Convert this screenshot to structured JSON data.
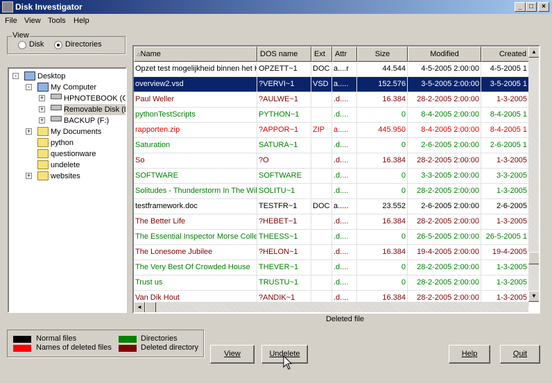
{
  "window": {
    "title": "Disk Investigator",
    "controls": [
      "_",
      "□",
      "×"
    ]
  },
  "menu": [
    "File",
    "View",
    "Tools",
    "Help"
  ],
  "view_group": {
    "label": "View",
    "options": [
      "Disk",
      "Directories"
    ],
    "selected": "Directories"
  },
  "tree": [
    {
      "label": "Desktop",
      "level": 0,
      "expander": "-",
      "icon": "desktop-icon"
    },
    {
      "label": "My Computer",
      "level": 1,
      "expander": "-",
      "icon": "computer-icon"
    },
    {
      "label": "HPNOTEBOOK (C:)",
      "level": 2,
      "expander": "+",
      "icon": "drive-icon"
    },
    {
      "label": "Removable Disk (D:)",
      "level": 2,
      "expander": "+",
      "icon": "drive-icon",
      "selected": true
    },
    {
      "label": "BACKUP (F:)",
      "level": 2,
      "expander": "+",
      "icon": "drive-icon"
    },
    {
      "label": "My Documents",
      "level": 1,
      "expander": "+",
      "icon": "documents-folder-icon"
    },
    {
      "label": "python",
      "level": 1,
      "expander": "",
      "icon": "folder-icon"
    },
    {
      "label": "questionware",
      "level": 1,
      "expander": "",
      "icon": "folder-icon"
    },
    {
      "label": "undelete",
      "level": 1,
      "expander": "",
      "icon": "folder-icon"
    },
    {
      "label": "websites",
      "level": 1,
      "expander": "+",
      "icon": "folder-icon"
    }
  ],
  "columns": [
    "Name",
    "DOS name",
    "Ext",
    "Attr",
    "Size",
    "Modified",
    "Created"
  ],
  "colors": {
    "normal": "#000000",
    "deleted_file": "#e00000",
    "directory": "#008000",
    "deleted_directory": "#800000",
    "selection": "#0a246a"
  },
  "rows": [
    {
      "type": "normal",
      "cells": [
        "Opzet test mogelijkheid binnen het Kc",
        "OPZETT~1",
        "DOC",
        "a....r",
        "44.544",
        "4-5-2005 2:00:00",
        "4-5-2005 1"
      ]
    },
    {
      "type": "deleted_file",
      "selected": true,
      "cells": [
        "overview2.vsd",
        "?VERVI~1",
        "VSD",
        "a.....",
        "152.576",
        "3-5-2005 2:00:00",
        "3-5-2005 1"
      ]
    },
    {
      "type": "deleted_directory",
      "cells": [
        "Paul Weller",
        "?AULWE~1",
        "",
        ".d....",
        "16.384",
        "28-2-2005 2:00:00",
        "1-3-2005"
      ]
    },
    {
      "type": "directory",
      "cells": [
        "pythonTestScripts",
        "PYTHON~1",
        "",
        ".d....",
        "0",
        "8-4-2005 2:00:00",
        "8-4-2005 1"
      ]
    },
    {
      "type": "deleted_file",
      "cells": [
        "rapporten.zip",
        "?APPOR~1",
        "ZIP",
        "a.....",
        "445.950",
        "8-4-2005 2:00:00",
        "8-4-2005 1"
      ]
    },
    {
      "type": "directory",
      "cells": [
        "Saturation",
        "SATURA~1",
        "",
        ".d....",
        "0",
        "2-6-2005 2:00:00",
        "2-6-2005 1"
      ]
    },
    {
      "type": "deleted_directory",
      "cells": [
        "So",
        "?O",
        "",
        ".d....",
        "16.384",
        "28-2-2005 2:00:00",
        "1-3-2005"
      ]
    },
    {
      "type": "directory",
      "cells": [
        "SOFTWARE",
        "SOFTWARE",
        "",
        ".d....",
        "0",
        "3-3-2005 2:00:00",
        "3-3-2005"
      ]
    },
    {
      "type": "directory",
      "cells": [
        "Solitudes - Thunderstorm In The Wild",
        "SOLITU~1",
        "",
        ".d....",
        "0",
        "28-2-2005 2:00:00",
        "1-3-2005"
      ]
    },
    {
      "type": "normal",
      "cells": [
        "testframework.doc",
        "TESTFR~1",
        "DOC",
        "a.....",
        "23.552",
        "2-6-2005 2:00:00",
        "2-6-2005"
      ]
    },
    {
      "type": "deleted_directory",
      "cells": [
        "The Better Life",
        "?HEBET~1",
        "",
        ".d....",
        "16.384",
        "28-2-2005 2:00:00",
        "1-3-2005"
      ]
    },
    {
      "type": "directory",
      "cells": [
        "The Essential Inspector Morse Collec",
        "THEESS~1",
        "",
        ".d....",
        "0",
        "26-5-2005 2:00:00",
        "26-5-2005 1"
      ]
    },
    {
      "type": "deleted_directory",
      "cells": [
        "The Lonesome Jubilee",
        "?HELON~1",
        "",
        ".d....",
        "16.384",
        "19-4-2005 2:00:00",
        "19-4-2005"
      ]
    },
    {
      "type": "directory",
      "cells": [
        "The Very Best Of Crowded House",
        "THEVER~1",
        "",
        ".d....",
        "0",
        "28-2-2005 2:00:00",
        "1-3-2005"
      ]
    },
    {
      "type": "directory",
      "cells": [
        "Trust us",
        "TRUSTU~1",
        "",
        ".d....",
        "0",
        "28-2-2005 2:00:00",
        "1-3-2005"
      ]
    },
    {
      "type": "deleted_directory",
      "cells": [
        "Van Dik Hout",
        "?ANDIK~1",
        "",
        ".d....",
        "16.384",
        "28-2-2005 2:00:00",
        "1-3-2005"
      ]
    }
  ],
  "status": "Deleted file",
  "legend": {
    "normal": "Normal files",
    "deleted_file": "Names of deleted files",
    "directory": "Directories",
    "deleted_directory": "Deleted directory"
  },
  "buttons": {
    "view": "View",
    "undelete": "Undelete",
    "help": "Help",
    "quit": "Quit"
  }
}
